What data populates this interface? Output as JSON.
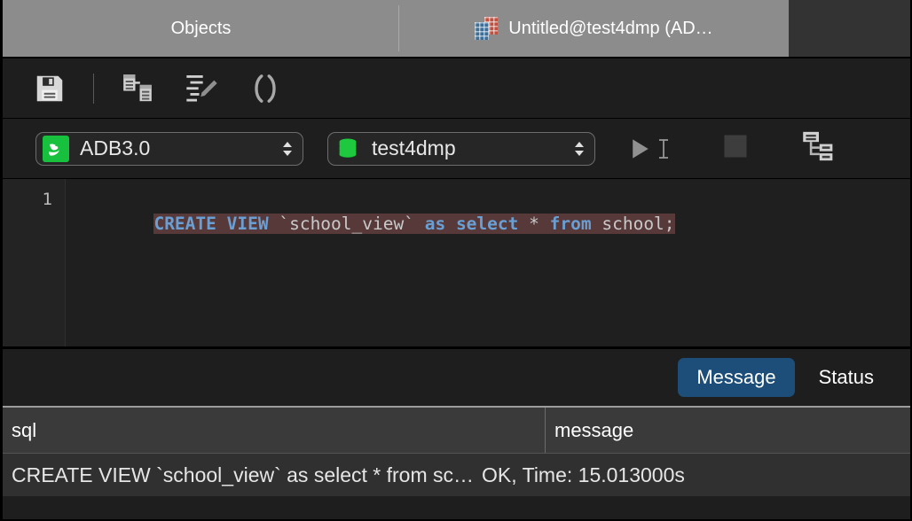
{
  "window": {
    "tabs": [
      {
        "label": "Objects",
        "icon": null,
        "active": false
      },
      {
        "label": "Untitled@test4dmp (AD…",
        "icon": "console-table-icon",
        "active": true
      }
    ]
  },
  "toolbar": {
    "buttons": [
      {
        "name": "save-icon",
        "label": "Save"
      },
      {
        "name": "explain-plan-icon",
        "label": "Explain"
      },
      {
        "name": "format-sql-icon",
        "label": "Format SQL"
      },
      {
        "name": "parentheses-icon",
        "label": "()"
      }
    ]
  },
  "connection_bar": {
    "connection": {
      "value": "ADB3.0",
      "icon": "adb-connection-icon",
      "accent": "#17c13e"
    },
    "database": {
      "value": "test4dmp",
      "icon": "database-icon",
      "accent": "#17c13e"
    },
    "run_label": "Run",
    "stop_label": "Stop",
    "plan_label": "Execution Plan"
  },
  "editor": {
    "line_numbers": [
      "1"
    ],
    "selection_color": "#57393a",
    "keyword_color": "#6a9fd4",
    "lines": [
      {
        "tokens": [
          {
            "t": "CREATE VIEW",
            "k": "kw"
          },
          {
            "t": " ",
            "k": "op"
          },
          {
            "t": "`school_view`",
            "k": "id"
          },
          {
            "t": " ",
            "k": "op"
          },
          {
            "t": "as select",
            "k": "kw"
          },
          {
            "t": " ",
            "k": "op"
          },
          {
            "t": "*",
            "k": "op"
          },
          {
            "t": " ",
            "k": "op"
          },
          {
            "t": "from",
            "k": "kw"
          },
          {
            "t": " ",
            "k": "op"
          },
          {
            "t": "school;",
            "k": "id"
          }
        ]
      }
    ],
    "full_text": "CREATE VIEW `school_view` as select * from school;"
  },
  "results": {
    "tabs": [
      {
        "label": "Message",
        "active": true
      },
      {
        "label": "Status",
        "active": false
      }
    ],
    "active_tab_color": "#1d4e79",
    "columns": [
      "sql",
      "message"
    ],
    "rows": [
      {
        "sql": "CREATE VIEW `school_view` as select * from sc…",
        "message": "OK, Time: 15.013000s"
      }
    ]
  }
}
